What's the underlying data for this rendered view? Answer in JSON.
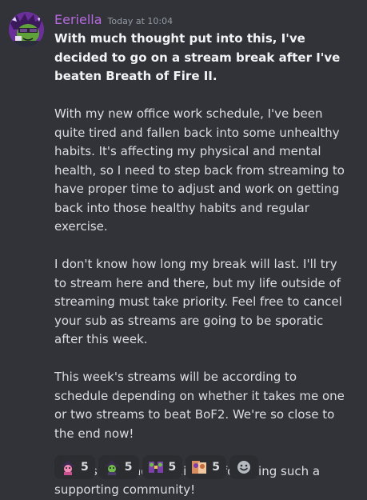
{
  "message": {
    "author": "Eeriella",
    "timestamp": "Today at 10:04",
    "paragraphs": [
      "With much thought put into this, I've decided to go on a stream break after I've beaten Breath of Fire II.",
      "With my new office work schedule, I've been quite tired and fallen back into some unhealthy habits. It's affecting my physical and mental health, so I need to step back from streaming to have proper time to adjust and work on getting back into those healthy habits and regular exercise.",
      "I don't know how long my break will last. I'll try to stream here and there, but my life outside of streaming must take priority. Feel free to cancel your sub as streams are going to be sporatic after this week.",
      "This week's streams will be according to schedule depending on whether it takes me one or two streams to beat BoF2. We're so close to the end now!",
      "Thanks for reading this and for being such a supporting community!"
    ]
  },
  "reactions": [
    {
      "emoji": "pink-witch-emoji",
      "count": "5"
    },
    {
      "emoji": "green-witch-emoji",
      "count": "5"
    },
    {
      "emoji": "purple-dance-emoji",
      "count": "5"
    },
    {
      "emoji": "orange-hug-emoji",
      "count": "5"
    }
  ],
  "add_reaction": {
    "icon": "add-reaction-icon"
  },
  "colors": {
    "background": "#313338",
    "username": "#b66adf",
    "text": "#dbdee1",
    "timestamp": "#949ba4",
    "reaction_bg": "#2b2d31"
  }
}
